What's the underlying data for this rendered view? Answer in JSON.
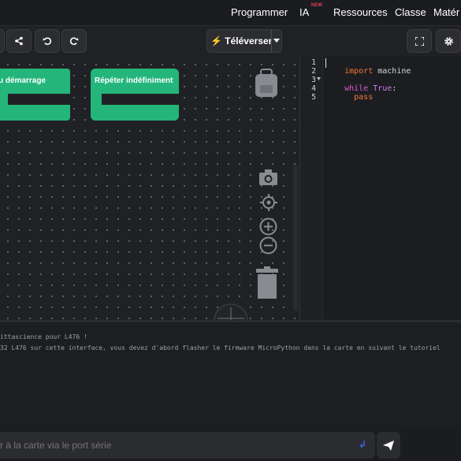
{
  "topnav": {
    "items": [
      "Programmer",
      "IA",
      "Ressources",
      "Classe",
      "Matér"
    ],
    "ia_badge": "NEW"
  },
  "toolbar": {
    "upload_label": "Téléverser",
    "share_icon": "share-icon",
    "undo_icon": "undo-icon",
    "redo_icon": "redo-icon",
    "fullscreen_icon": "fullscreen-icon",
    "settings_icon": "gear-icon"
  },
  "workspace": {
    "blocks": [
      {
        "label": "u démarrage"
      },
      {
        "label": "Répéter indéfiniment"
      }
    ],
    "block_color": "#23b57a",
    "tools": [
      "backpack-icon",
      "camera-icon",
      "target-icon",
      "zoom-in-icon",
      "zoom-out-icon",
      "trash-icon"
    ]
  },
  "editor": {
    "line_numbers": [
      "1",
      "2",
      "3",
      "4",
      "5"
    ],
    "lines": [
      {
        "kw": "import",
        "rest": " machine"
      },
      {
        "kw": "",
        "rest": ""
      },
      {
        "kw": "while",
        "rest2": "True",
        "rest": ":"
      },
      {
        "kw": "  pass",
        "rest": ""
      },
      {
        "kw": "",
        "rest": ""
      }
    ]
  },
  "console": {
    "lines": [
      "ittascience pour L476 !",
      "32 L476 sur cette interface, vous devez d'abord flasher le firmware MicroPython dans la carte en suivant le tutoriel"
    ]
  },
  "serial": {
    "placeholder": "r à la carte via le port série"
  },
  "colors": {
    "keyword_import": "#f07838",
    "keyword_while": "#e05ad6",
    "keyword_true": "#c879e8",
    "keyword_pass": "#f07838",
    "accent": "#23b57a"
  }
}
